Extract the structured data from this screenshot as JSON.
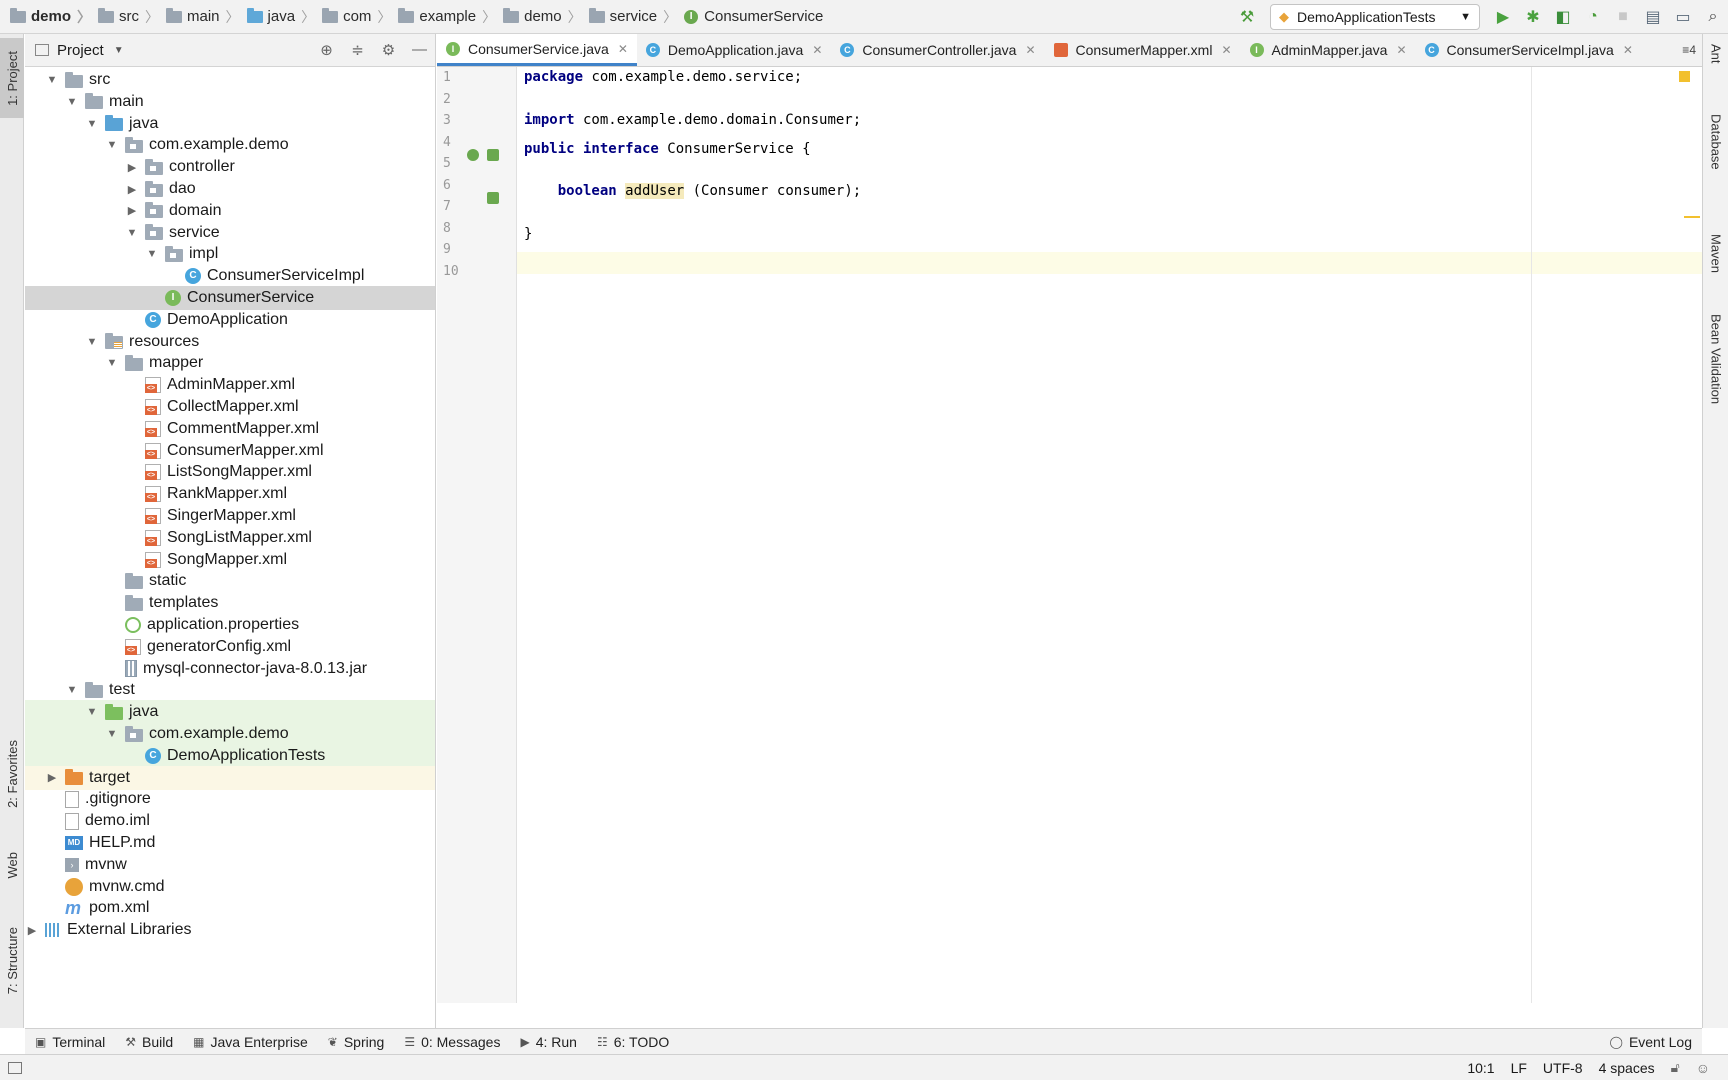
{
  "navbar": {
    "crumbs": [
      "demo",
      "src",
      "main",
      "java",
      "com",
      "example",
      "demo",
      "service",
      "ConsumerService"
    ],
    "run_config": "DemoApplicationTests"
  },
  "left_strip": {
    "tabs": [
      "1: Project",
      "2: Favorites",
      "Web",
      "7: Structure"
    ]
  },
  "right_strip": {
    "tabs": [
      "Ant",
      "Database",
      "Maven",
      "Bean Validation"
    ]
  },
  "project": {
    "title": "Project",
    "tree": [
      {
        "label": "src",
        "depth": 0,
        "icon": "folder",
        "arrow": "down"
      },
      {
        "label": "main",
        "depth": 1,
        "icon": "folder",
        "arrow": "down"
      },
      {
        "label": "java",
        "depth": 2,
        "icon": "folder-blue",
        "arrow": "down"
      },
      {
        "label": "com.example.demo",
        "depth": 3,
        "icon": "package",
        "arrow": "down"
      },
      {
        "label": "controller",
        "depth": 4,
        "icon": "package",
        "arrow": "right"
      },
      {
        "label": "dao",
        "depth": 4,
        "icon": "package",
        "arrow": "right"
      },
      {
        "label": "domain",
        "depth": 4,
        "icon": "package",
        "arrow": "right"
      },
      {
        "label": "service",
        "depth": 4,
        "icon": "package",
        "arrow": "down"
      },
      {
        "label": "impl",
        "depth": 5,
        "icon": "package",
        "arrow": "down"
      },
      {
        "label": "ConsumerServiceImpl",
        "depth": 6,
        "icon": "class",
        "arrow": "none"
      },
      {
        "label": "ConsumerService",
        "depth": 5,
        "icon": "interface",
        "arrow": "none",
        "state": "selected"
      },
      {
        "label": "DemoApplication",
        "depth": 4,
        "icon": "class",
        "arrow": "none"
      },
      {
        "label": "resources",
        "depth": 2,
        "icon": "resources",
        "arrow": "down"
      },
      {
        "label": "mapper",
        "depth": 3,
        "icon": "folder",
        "arrow": "down"
      },
      {
        "label": "AdminMapper.xml",
        "depth": 4,
        "icon": "xml",
        "arrow": "none"
      },
      {
        "label": "CollectMapper.xml",
        "depth": 4,
        "icon": "xml",
        "arrow": "none"
      },
      {
        "label": "CommentMapper.xml",
        "depth": 4,
        "icon": "xml",
        "arrow": "none"
      },
      {
        "label": "ConsumerMapper.xml",
        "depth": 4,
        "icon": "xml",
        "arrow": "none"
      },
      {
        "label": "ListSongMapper.xml",
        "depth": 4,
        "icon": "xml",
        "arrow": "none"
      },
      {
        "label": "RankMapper.xml",
        "depth": 4,
        "icon": "xml",
        "arrow": "none"
      },
      {
        "label": "SingerMapper.xml",
        "depth": 4,
        "icon": "xml",
        "arrow": "none"
      },
      {
        "label": "SongListMapper.xml",
        "depth": 4,
        "icon": "xml",
        "arrow": "none"
      },
      {
        "label": "SongMapper.xml",
        "depth": 4,
        "icon": "xml",
        "arrow": "none"
      },
      {
        "label": "static",
        "depth": 3,
        "icon": "folder",
        "arrow": "none"
      },
      {
        "label": "templates",
        "depth": 3,
        "icon": "folder",
        "arrow": "none"
      },
      {
        "label": "application.properties",
        "depth": 3,
        "icon": "properties",
        "arrow": "none"
      },
      {
        "label": "generatorConfig.xml",
        "depth": 3,
        "icon": "xml",
        "arrow": "none"
      },
      {
        "label": "mysql-connector-java-8.0.13.jar",
        "depth": 3,
        "icon": "jar",
        "arrow": "none"
      },
      {
        "label": "test",
        "depth": 1,
        "icon": "folder",
        "arrow": "down"
      },
      {
        "label": "java",
        "depth": 2,
        "icon": "folder-green",
        "arrow": "down",
        "state": "test"
      },
      {
        "label": "com.example.demo",
        "depth": 3,
        "icon": "package",
        "arrow": "down",
        "state": "test"
      },
      {
        "label": "DemoApplicationTests",
        "depth": 4,
        "icon": "class",
        "arrow": "none",
        "state": "test"
      },
      {
        "label": "target",
        "depth": 0,
        "icon": "folder-orange",
        "arrow": "right",
        "state": "excluded"
      },
      {
        "label": ".gitignore",
        "depth": 0,
        "icon": "file",
        "arrow": "none"
      },
      {
        "label": "demo.iml",
        "depth": 0,
        "icon": "file",
        "arrow": "none"
      },
      {
        "label": "HELP.md",
        "depth": 0,
        "icon": "markdown",
        "arrow": "none"
      },
      {
        "label": "mvnw",
        "depth": 0,
        "icon": "terminal",
        "arrow": "none"
      },
      {
        "label": "mvnw.cmd",
        "depth": 0,
        "icon": "gear",
        "arrow": "none"
      },
      {
        "label": "pom.xml",
        "depth": 0,
        "icon": "maven",
        "arrow": "none"
      },
      {
        "label": "External Libraries",
        "depth": -1,
        "icon": "library",
        "arrow": "right"
      }
    ]
  },
  "editor": {
    "tabs": [
      {
        "label": "ConsumerService.java",
        "icon": "i",
        "active": true
      },
      {
        "label": "DemoApplication.java",
        "icon": "c",
        "active": false
      },
      {
        "label": "ConsumerController.java",
        "icon": "c",
        "active": false
      },
      {
        "label": "ConsumerMapper.xml",
        "icon": "x",
        "active": false
      },
      {
        "label": "AdminMapper.java",
        "icon": "i",
        "active": false
      },
      {
        "label": "ConsumerServiceImpl.java",
        "icon": "c",
        "active": false
      }
    ],
    "tabs_more": "4",
    "line_numbers": [
      "1",
      "2",
      "3",
      "4",
      "5",
      "6",
      "7",
      "8",
      "9",
      "10"
    ],
    "code": {
      "l1_kw": "package",
      "l1_rest": " com.example.demo.service;",
      "l3_kw": "import",
      "l3_rest": " com.example.demo.domain.Consumer;",
      "l5_kw": "public interface",
      "l5_rest": " ConsumerService {",
      "l7_indent": "    ",
      "l7_kw": "boolean",
      "l7_sp": " ",
      "l7_method": "addUser",
      "l7_rest": " (Consumer consumer);",
      "l9": "}"
    }
  },
  "bottom_tools": [
    {
      "label": "Terminal",
      "icon": "terminal-icon",
      "glyph": "▣"
    },
    {
      "label": "Build",
      "icon": "hammer-icon",
      "glyph": "⚒"
    },
    {
      "label": "Java Enterprise",
      "icon": "enterprise-icon",
      "glyph": "▦"
    },
    {
      "label": "Spring",
      "icon": "spring-icon",
      "glyph": "❦"
    },
    {
      "label": "0: Messages",
      "icon": "messages-icon",
      "glyph": "☰"
    },
    {
      "label": "4: Run",
      "icon": "run-icon",
      "glyph": "▶"
    },
    {
      "label": "6: TODO",
      "icon": "todo-icon",
      "glyph": "☷"
    }
  ],
  "event_log": "Event Log",
  "status": {
    "position": "10:1",
    "line_sep": "LF",
    "encoding": "UTF-8",
    "indent": "4 spaces"
  }
}
